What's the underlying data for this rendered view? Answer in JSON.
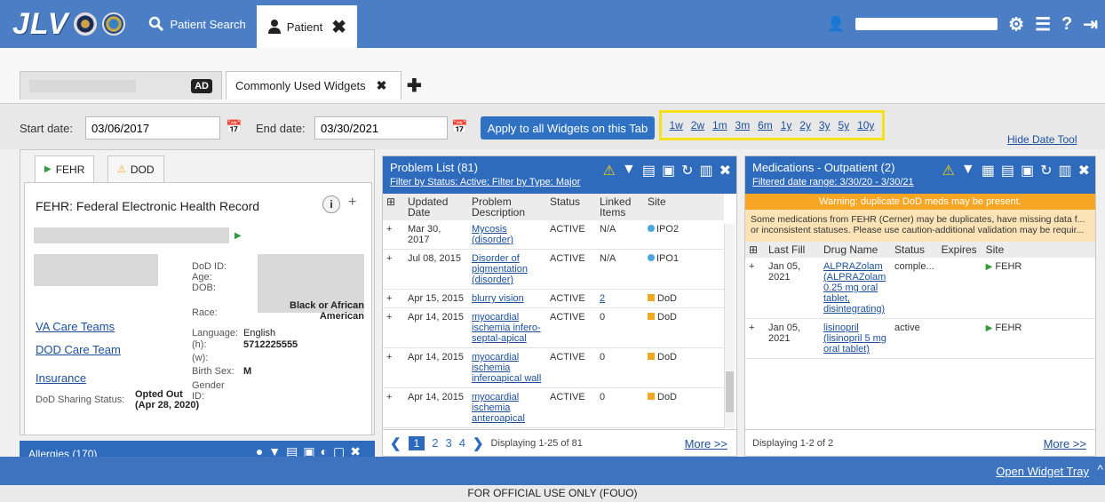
{
  "app": {
    "logo": "JLV"
  },
  "top_nav": {
    "patient_search": "Patient Search",
    "patient_tab": "Patient"
  },
  "tabs": {
    "ad_badge": "AD",
    "common_widgets": "Commonly Used Widgets"
  },
  "date_bar": {
    "start_label": "Start date:",
    "start_value": "03/06/2017",
    "end_label": "End date:",
    "end_value": "03/30/2021",
    "apply_label": "Apply to all Widgets on this Tab",
    "quick_ranges": [
      "1w",
      "2w",
      "1m",
      "3m",
      "6m",
      "1y",
      "2y",
      "3y",
      "5y",
      "10y"
    ],
    "hide_label": "Hide Date Tool"
  },
  "demographics": {
    "tab_fehr": "FEHR",
    "tab_dod": "DOD",
    "title": "FEHR: Federal Electronic Health Record",
    "info_icon_text": "i",
    "labels": {
      "dod_id": "DoD ID:",
      "age": "Age:",
      "dob": "DOB:",
      "race": "Race:",
      "language": "Language:",
      "phone_h": "(h):",
      "phone_w": "(w):",
      "birth_sex": "Birth Sex:",
      "gender": "Gender",
      "id": "ID:",
      "sharing": "DoD Sharing Status:"
    },
    "values": {
      "race": "Black or African American",
      "language": "English",
      "phone_h": "5712225555",
      "birth_sex": "M",
      "sharing": "Opted Out (Apr 28, 2020)"
    },
    "links": {
      "va_care": "VA Care Teams",
      "dod_care": "DOD Care Team",
      "insurance": "Insurance"
    }
  },
  "allergies": {
    "title": "Allergies (170)"
  },
  "problem_list": {
    "title": "Problem List (81)",
    "filter": "Filter by Status: Active; Filter by Type: Major",
    "columns": [
      "Updated Date",
      "Problem Description",
      "Status",
      "Linked Items",
      "Site"
    ],
    "rows": [
      {
        "date": "Mar 30, 2017",
        "desc": "Mycosis (disorder)",
        "status": "ACTIVE",
        "linked": "N/A",
        "site": "IPO2",
        "site_type": "dot"
      },
      {
        "date": "Jul 08, 2015",
        "desc": "Disorder of pigmentation (disorder)",
        "status": "ACTIVE",
        "linked": "N/A",
        "site": "IPO1",
        "site_type": "dot"
      },
      {
        "date": "Apr 15, 2015",
        "desc": "blurry vision",
        "status": "ACTIVE",
        "linked": "2",
        "site": "DoD",
        "site_type": "sq"
      },
      {
        "date": "Apr 14, 2015",
        "desc": "myocardial ischemia infero-septal-apical",
        "status": "ACTIVE",
        "linked": "0",
        "site": "DoD",
        "site_type": "sq"
      },
      {
        "date": "Apr 14, 2015",
        "desc": "myocardial ischemia inferoapical wall",
        "status": "ACTIVE",
        "linked": "0",
        "site": "DoD",
        "site_type": "sq"
      },
      {
        "date": "Apr 14, 2015",
        "desc": "myocardial ischemia anteroapical",
        "status": "ACTIVE",
        "linked": "0",
        "site": "DoD",
        "site_type": "sq"
      }
    ],
    "pages": [
      "1",
      "2",
      "3",
      "4"
    ],
    "displaying": "Displaying 1-25 of 81",
    "more": "More >>"
  },
  "medications": {
    "title": "Medications - Outpatient (2)",
    "filter": "Filtered date range: 3/30/20 - 3/30/21",
    "warning_title": "Warning: duplicate DoD meds may be present.",
    "warning_text": "Some medications from FEHR (Cerner) may be duplicates, have missing data f... or inconsistent statuses. Please use caution-additional validation may be requir...",
    "columns": [
      "Last Fill",
      "Drug Name",
      "Status",
      "Expires",
      "Site"
    ],
    "rows": [
      {
        "fill": "Jan 05, 2021",
        "drug": "ALPRAZolam (ALPRAZolam 0.25 mg oral tablet, disintegrating)",
        "status": "comple...",
        "expires": "",
        "site": "FEHR"
      },
      {
        "fill": "Jan 05, 2021",
        "drug": "lisinopril (lisinopril 5 mg oral tablet)",
        "status": "active",
        "expires": "",
        "site": "FEHR"
      }
    ],
    "displaying": "Displaying 1-2 of 2",
    "more": "More >>"
  },
  "bottom": {
    "open_tray": "Open Widget Tray",
    "footer": "FOR OFFICIAL USE ONLY (FOUO)"
  },
  "colors": {
    "header_blue": "#4b7ec4",
    "widget_blue": "#2f6bbd",
    "highlight_yellow": "#f3e21b",
    "warning_orange": "#f6a623"
  }
}
